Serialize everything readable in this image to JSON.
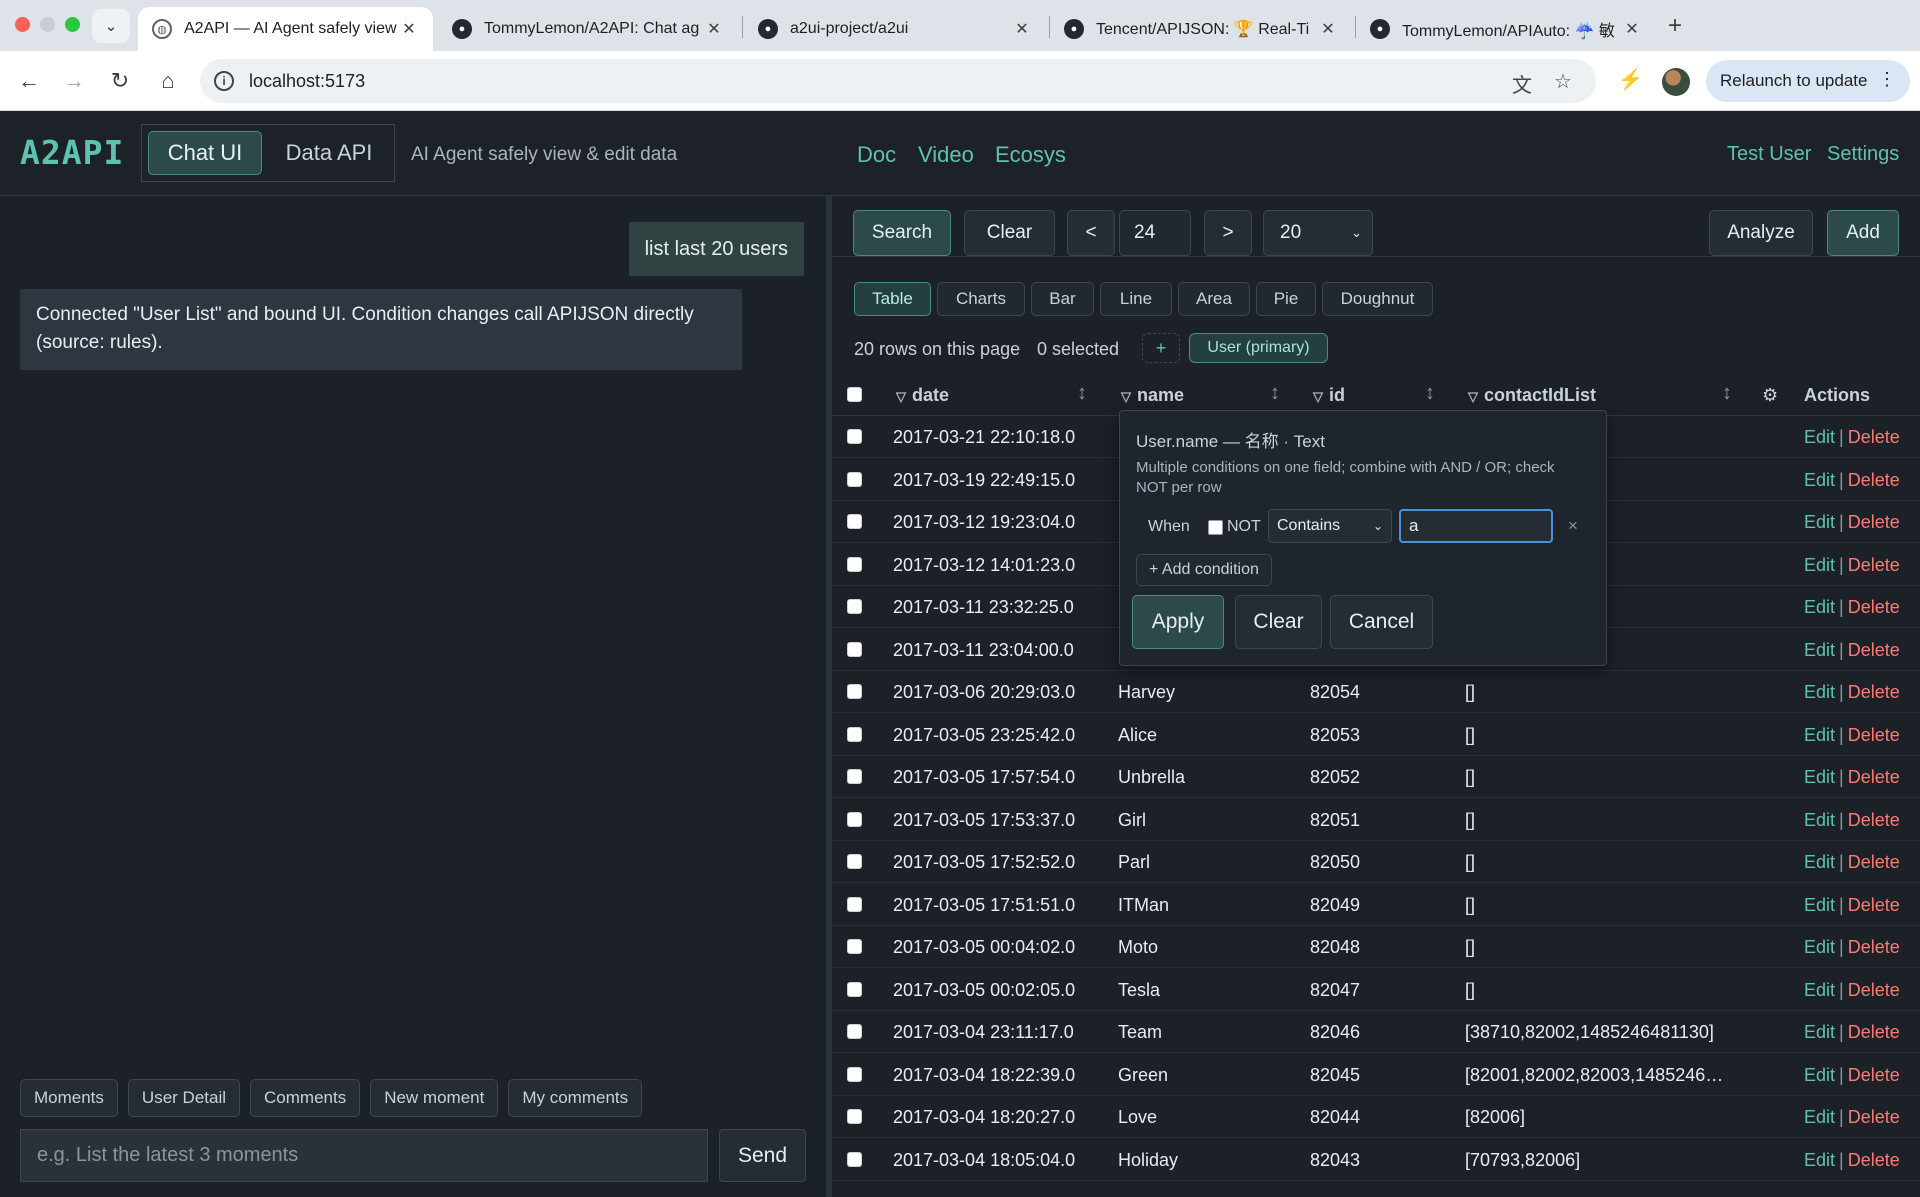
{
  "browser": {
    "tabs": [
      {
        "title": "A2API — AI Agent safely view",
        "icon": "globe-icon",
        "active": true
      },
      {
        "title": "TommyLemon/A2API: Chat ag",
        "icon": "github-icon",
        "active": false
      },
      {
        "title": "a2ui-project/a2ui",
        "icon": "github-icon",
        "active": false
      },
      {
        "title": "Tencent/APIJSON: 🏆 Real-Ti",
        "icon": "github-icon",
        "active": false
      },
      {
        "title": "TommyLemon/APIAuto: ☔ 敏",
        "icon": "github-icon",
        "active": false
      }
    ],
    "url": "localhost:5173",
    "relaunch_label": "Relaunch to update"
  },
  "header": {
    "logo": "A2API",
    "mode_tabs": [
      "Chat UI",
      "Data API"
    ],
    "active_mode": "Chat UI",
    "tagline": "AI Agent safely view & edit data",
    "nav": [
      "Doc",
      "Video",
      "Ecosys"
    ],
    "user": "Test User",
    "settings": "Settings"
  },
  "chat": {
    "user_message": "list last 20 users",
    "bot_message": "Connected \"User List\" and bound UI. Condition changes call APIJSON directly (source: rules).",
    "quick_chips": [
      "Moments",
      "User Detail",
      "Comments",
      "New moment",
      "My comments"
    ],
    "input_placeholder": "e.g. List the latest 3 moments",
    "send_label": "Send"
  },
  "controls": {
    "search": "Search",
    "clear": "Clear",
    "prev": "<",
    "page": "24",
    "next": ">",
    "page_size": "20",
    "analyze": "Analyze",
    "add": "Add"
  },
  "view_tabs": [
    "Table",
    "Charts",
    "Bar",
    "Line",
    "Area",
    "Pie",
    "Doughnut"
  ],
  "active_view": "Table",
  "status": {
    "rows": "20 rows on this page",
    "selected": "0 selected",
    "plus": "+",
    "primary": "User (primary)"
  },
  "table": {
    "columns": [
      "date",
      "name",
      "id",
      "contactIdList"
    ],
    "settings_icon": "gear-icon",
    "actions_header": "Actions",
    "edit_label": "Edit",
    "delete_label": "Delete",
    "action_sep": "|",
    "rows": [
      {
        "date": "2017-03-21 22:10:18.0",
        "name": "",
        "id": "",
        "contactIdList": ""
      },
      {
        "date": "2017-03-19 22:49:15.0",
        "name": "",
        "id": "",
        "contactIdList": ""
      },
      {
        "date": "2017-03-12 19:23:04.0",
        "name": "",
        "id": "",
        "contactIdList": ""
      },
      {
        "date": "2017-03-12 14:01:23.0",
        "name": "",
        "id": "",
        "contactIdList": ""
      },
      {
        "date": "2017-03-11 23:32:25.0",
        "name": "",
        "id": "",
        "contactIdList": ""
      },
      {
        "date": "2017-03-11 23:04:00.0",
        "name": "",
        "id": "",
        "contactIdList": ""
      },
      {
        "date": "2017-03-06 20:29:03.0",
        "name": "Harvey",
        "id": "82054",
        "contactIdList": "[]"
      },
      {
        "date": "2017-03-05 23:25:42.0",
        "name": "Alice",
        "id": "82053",
        "contactIdList": "[]"
      },
      {
        "date": "2017-03-05 17:57:54.0",
        "name": "Unbrella",
        "id": "82052",
        "contactIdList": "[]"
      },
      {
        "date": "2017-03-05 17:53:37.0",
        "name": "Girl",
        "id": "82051",
        "contactIdList": "[]"
      },
      {
        "date": "2017-03-05 17:52:52.0",
        "name": "Parl",
        "id": "82050",
        "contactIdList": "[]"
      },
      {
        "date": "2017-03-05 17:51:51.0",
        "name": "ITMan",
        "id": "82049",
        "contactIdList": "[]"
      },
      {
        "date": "2017-03-05 00:04:02.0",
        "name": "Moto",
        "id": "82048",
        "contactIdList": "[]"
      },
      {
        "date": "2017-03-05 00:02:05.0",
        "name": "Tesla",
        "id": "82047",
        "contactIdList": "[]"
      },
      {
        "date": "2017-03-04 23:11:17.0",
        "name": "Team",
        "id": "82046",
        "contactIdList": "[38710,82002,1485246481130]"
      },
      {
        "date": "2017-03-04 18:22:39.0",
        "name": "Green",
        "id": "82045",
        "contactIdList": "[82001,82002,82003,1485246…"
      },
      {
        "date": "2017-03-04 18:20:27.0",
        "name": "Love",
        "id": "82044",
        "contactIdList": "[82006]"
      },
      {
        "date": "2017-03-04 18:05:04.0",
        "name": "Holiday",
        "id": "82043",
        "contactIdList": "[70793,82006]"
      }
    ]
  },
  "filter_popover": {
    "title": "User.name — 名称 · Text",
    "help": "Multiple conditions on one field; combine with AND / OR; check NOT per row",
    "when_label": "When",
    "not_label": "NOT",
    "operator": "Contains",
    "value": "a",
    "remove": "×",
    "add_condition": "+ Add condition",
    "apply": "Apply",
    "clear": "Clear",
    "cancel": "Cancel"
  },
  "colors": {
    "accent": "#5ec2b0",
    "delete": "#ff7b72",
    "panel": "#1c2128",
    "teal_button": "#2b4a49"
  }
}
